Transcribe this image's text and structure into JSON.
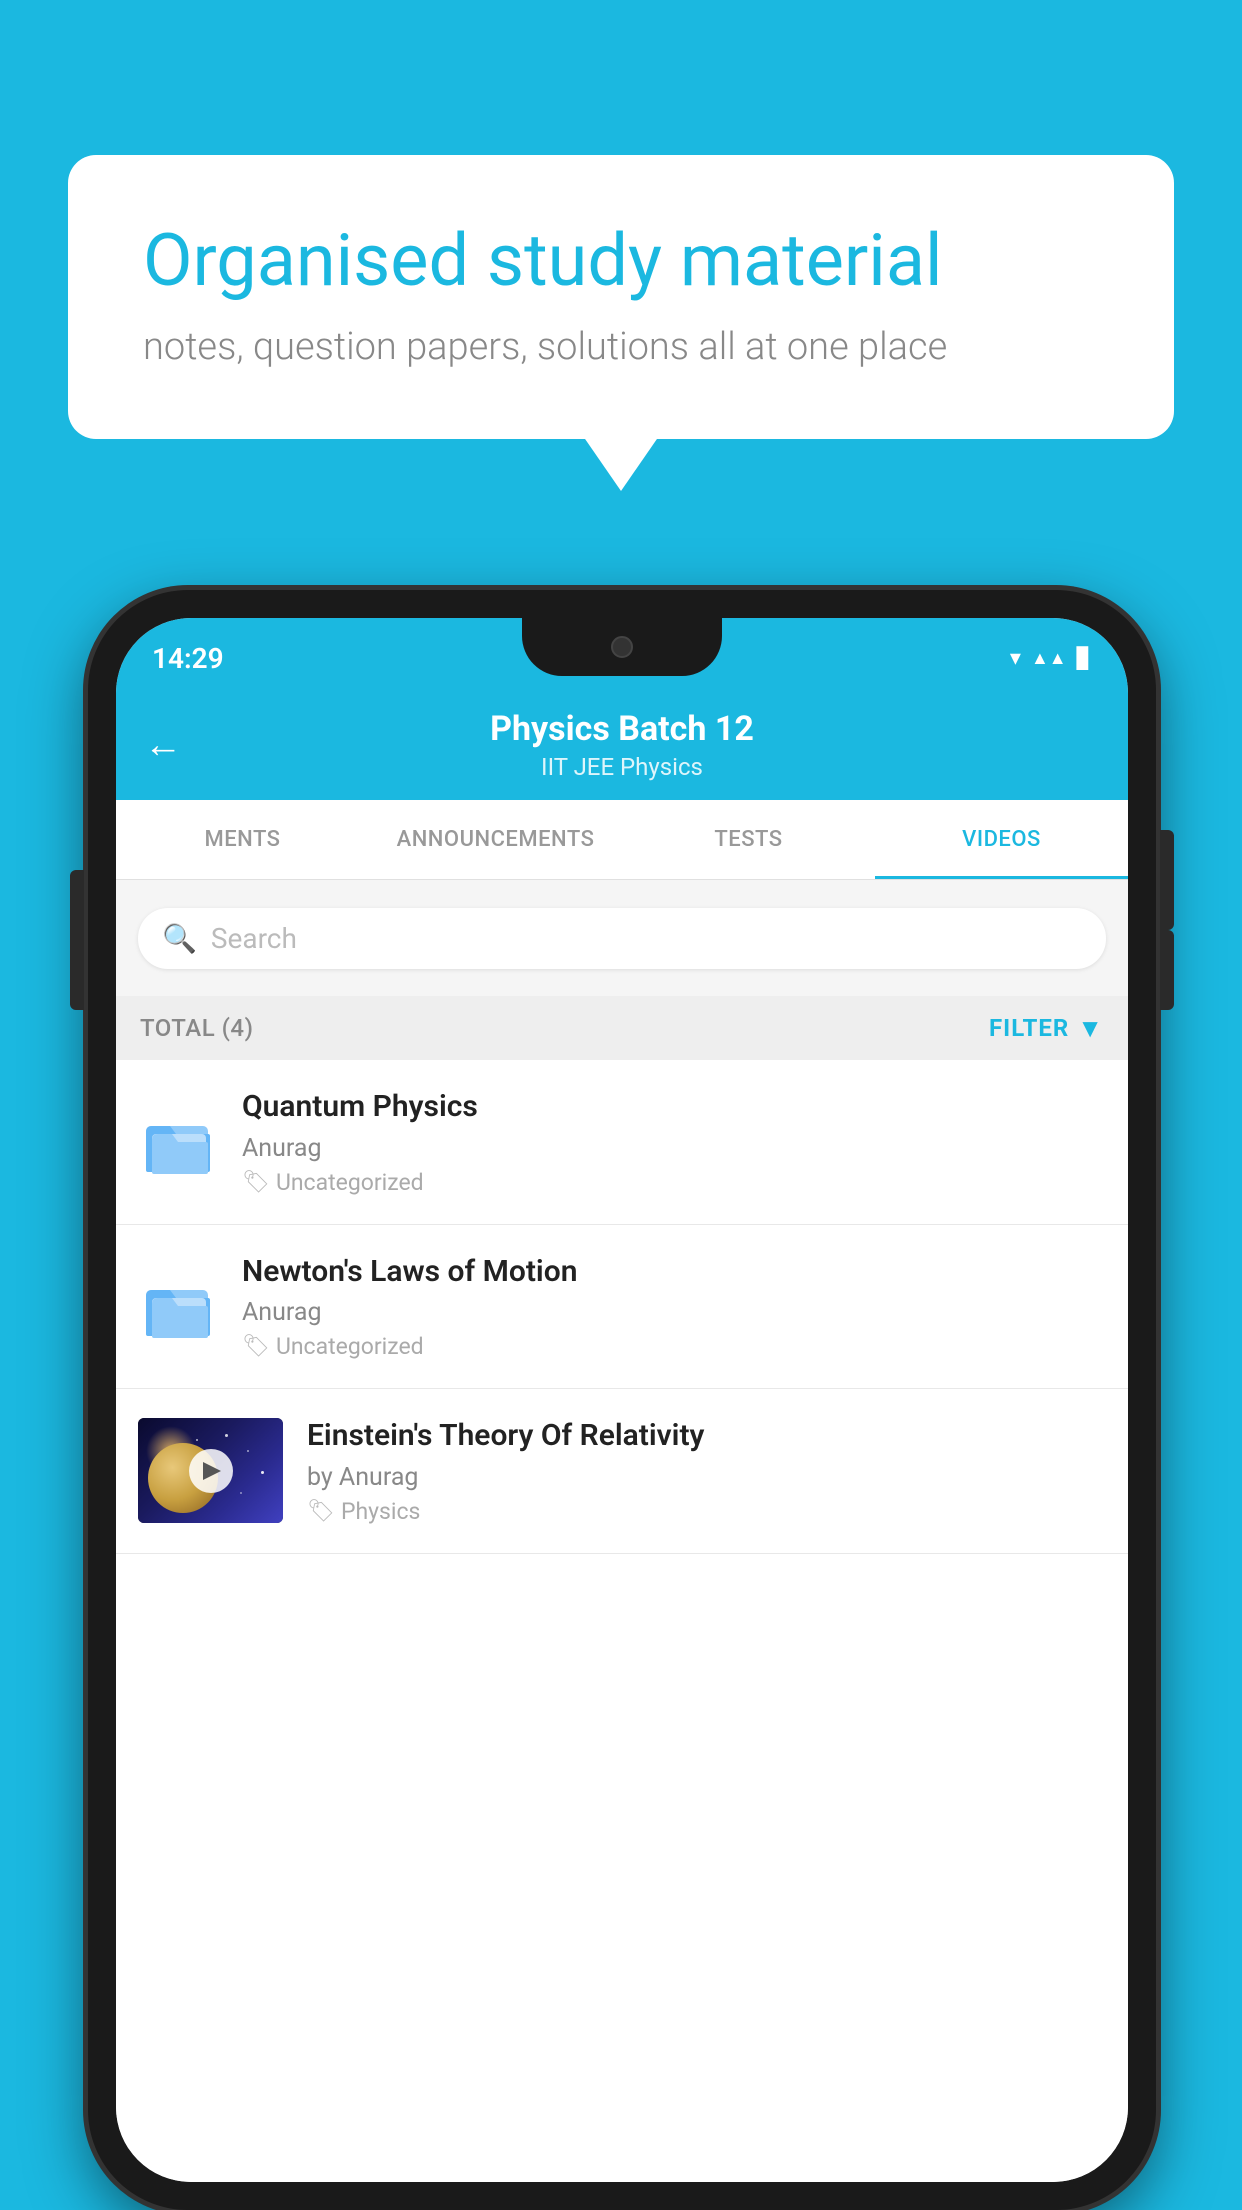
{
  "background": {
    "color": "#1bb8e0"
  },
  "speech_bubble": {
    "title": "Organised study material",
    "subtitle": "notes, question papers, solutions all at one place"
  },
  "status_bar": {
    "time": "14:29",
    "icons": [
      "wifi",
      "signal",
      "battery"
    ]
  },
  "header": {
    "title": "Physics Batch 12",
    "subtitle": "IIT JEE   Physics",
    "back_label": "←"
  },
  "tabs": [
    {
      "label": "MENTS",
      "active": false
    },
    {
      "label": "ANNOUNCEMENTS",
      "active": false
    },
    {
      "label": "TESTS",
      "active": false
    },
    {
      "label": "VIDEOS",
      "active": true
    }
  ],
  "search": {
    "placeholder": "Search"
  },
  "filter_row": {
    "total_label": "TOTAL (4)",
    "filter_label": "FILTER"
  },
  "videos": [
    {
      "id": 1,
      "title": "Quantum Physics",
      "author": "Anurag",
      "tag": "Uncategorized",
      "type": "folder",
      "has_thumb": false
    },
    {
      "id": 2,
      "title": "Newton's Laws of Motion",
      "author": "Anurag",
      "tag": "Uncategorized",
      "type": "folder",
      "has_thumb": false
    },
    {
      "id": 3,
      "title": "Einstein's Theory Of Relativity",
      "author": "by Anurag",
      "tag": "Physics",
      "type": "video",
      "has_thumb": true
    }
  ]
}
